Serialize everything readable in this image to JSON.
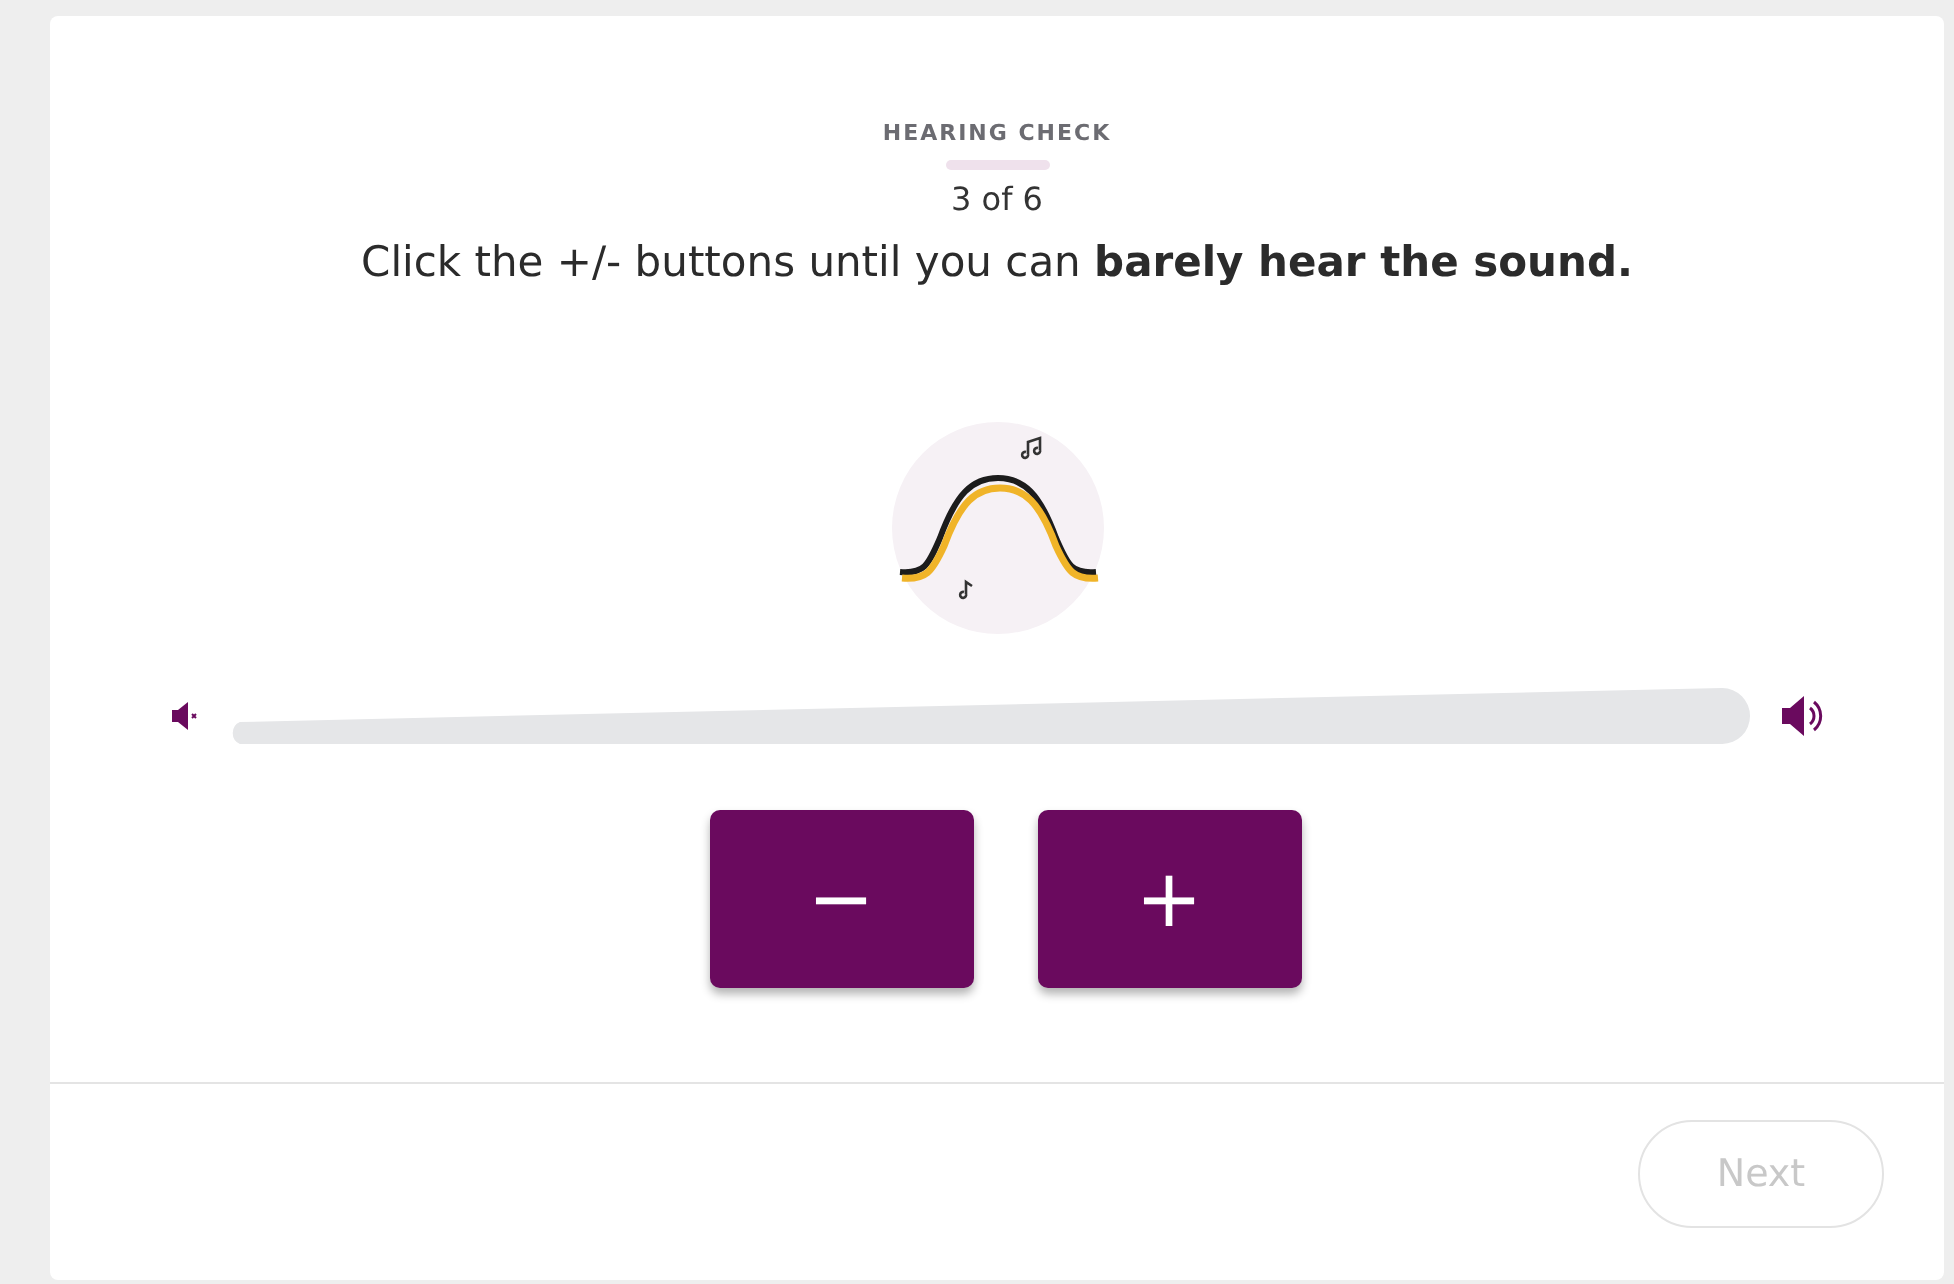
{
  "header": {
    "eyebrow": "HEARING CHECK",
    "step": "3 of 6"
  },
  "instruction": "Click the +/- buttons until you can **barely hear the sound.**",
  "volume_buttons": [
    {
      "label": "−"
    },
    {
      "label": "+"
    }
  ],
  "footer": {
    "next_button": {
      "label": "Next",
      "disabled": true
    }
  }
}
